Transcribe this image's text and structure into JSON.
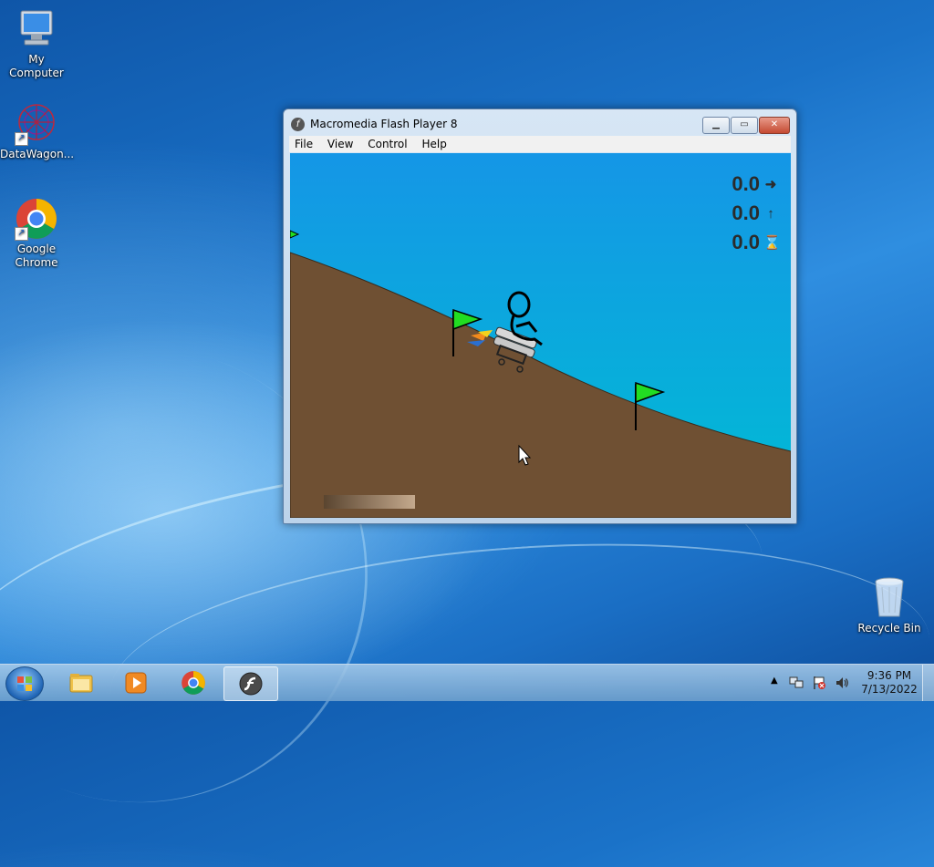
{
  "desktop": {
    "icons": [
      {
        "label": "My Computer"
      },
      {
        "label": "DataWagon..."
      },
      {
        "label": "Google Chrome"
      },
      {
        "label": "Recycle Bin"
      }
    ]
  },
  "window": {
    "title": "Macromedia Flash Player 8",
    "menu": [
      "File",
      "View",
      "Control",
      "Help"
    ],
    "controls": {
      "minimize": "▁",
      "maximize": "▭",
      "close": "✕"
    }
  },
  "game": {
    "speed": {
      "value": "0.0",
      "icon": "arrow-right-icon"
    },
    "height": {
      "value": "0.0",
      "icon": "arrow-up-icon"
    },
    "airtime": {
      "value": "0.0",
      "icon": "hourglass-icon"
    },
    "power_level": 0.6,
    "colors": {
      "sky": "#0f9ee0",
      "ground": "#6f5033",
      "flag": "#22dd22"
    }
  },
  "taskbar": {
    "apps": [
      {
        "name": "windows-explorer"
      },
      {
        "name": "media-player"
      },
      {
        "name": "google-chrome"
      },
      {
        "name": "flash-player",
        "active": true
      }
    ],
    "clock": {
      "time": "9:36 PM",
      "date": "7/13/2022"
    }
  }
}
